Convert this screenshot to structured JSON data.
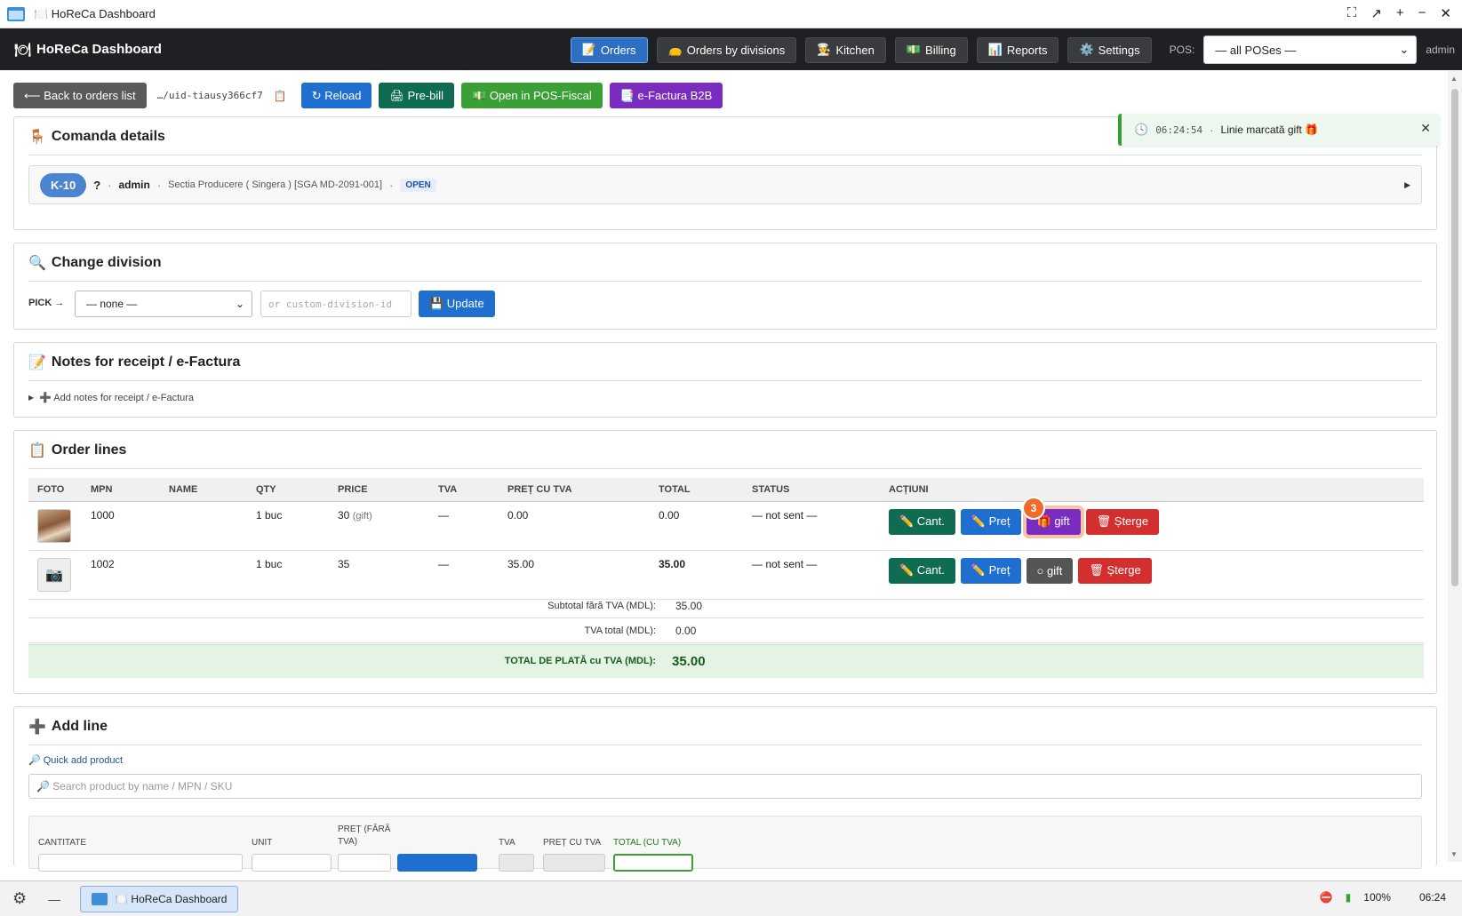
{
  "window": {
    "title": "🍽️ HoReCa Dashboard"
  },
  "navbar": {
    "brand": "HoReCa Dashboard",
    "items": [
      {
        "icon": "📝",
        "label": "Orders",
        "active": true
      },
      {
        "icon": "👝",
        "label": "Orders by divisions",
        "active": false
      },
      {
        "icon": "👨‍🍳",
        "label": "Kitchen",
        "active": false
      },
      {
        "icon": "💵",
        "label": "Billing",
        "active": false
      },
      {
        "icon": "📊",
        "label": "Reports",
        "active": false
      },
      {
        "icon": "⚙️",
        "label": "Settings",
        "active": false
      }
    ],
    "pos_label": "POS:",
    "pos_selected": "— all POSes —",
    "user": "admin"
  },
  "toolbar": {
    "back": "⟵ Back to orders list",
    "uid": "…/uid-tiausy366cf7",
    "reload": "↻ Reload",
    "prebill": "🖨 Pre-bill",
    "pos_fiscal": "💵 Open in POS-Fiscal",
    "efactura": "📑 e-Factura B2B"
  },
  "toast": {
    "time": "06:24:54",
    "sep": "·",
    "message": "Linie marcată gift 🎁"
  },
  "details": {
    "title": "Comanda details",
    "table": "K-10",
    "q": "?",
    "user": "admin",
    "section": "Sectia Producere ( Singera ) [SGA MD-2091-001]",
    "status": "OPEN"
  },
  "division": {
    "title": "Change division",
    "pick_label": "PICK →",
    "select_value": "— none —",
    "custom_placeholder": "or custom-division-id",
    "update": "💾 Update"
  },
  "notes": {
    "title": "Notes for receipt / e-Factura",
    "toggle": "➕ Add notes for receipt / e-Factura"
  },
  "order_lines": {
    "title": "Order lines",
    "headers": [
      "FOTO",
      "MPN",
      "NAME",
      "QTY",
      "PRICE",
      "TVA",
      "PREȚ CU TVA",
      "TOTAL",
      "STATUS",
      "ACȚIUNI"
    ],
    "rows": [
      {
        "mpn": "1000",
        "name": "",
        "qty": "1 buc",
        "price": "30",
        "price_note": "(gift)",
        "tva": "—",
        "pret_tva": "0.00",
        "total": "0.00",
        "status": "— not sent —",
        "gift_label": "🎁 gift"
      },
      {
        "mpn": "1002",
        "name": "",
        "qty": "1 buc",
        "price": "35",
        "price_note": "",
        "tva": "—",
        "pret_tva": "35.00",
        "total": "35.00",
        "status": "— not sent —",
        "gift_label": "○ gift"
      }
    ],
    "actions": {
      "cant": "✏️ Cant.",
      "pret": "✏️ Preț",
      "sterge": "🗑 Șterge"
    },
    "step_badge": "3",
    "subtotal_label": "Subtotal fără TVA (MDL):",
    "subtotal_value": "35.00",
    "tva_label": "TVA total (MDL):",
    "tva_value": "0.00",
    "grand_label": "TOTAL DE PLATĂ cu TVA (MDL):",
    "grand_value": "35.00"
  },
  "add_line": {
    "title": "Add line",
    "quick": "🔎 Quick add product",
    "search_placeholder": "🔎 Search product by name / MPN / SKU",
    "labels": {
      "cantitate": "CANTITATE",
      "unit": "UNIT",
      "pret": "PREȚ (FĂRĂ TVA)",
      "tva": "TVA",
      "pret_tva": "PREȚ CU TVA",
      "total": "TOTAL (CU TVA)"
    }
  },
  "taskbar": {
    "task": "🍽️ HoReCa Dashboard",
    "battery": "100%",
    "clock": "06:24"
  }
}
